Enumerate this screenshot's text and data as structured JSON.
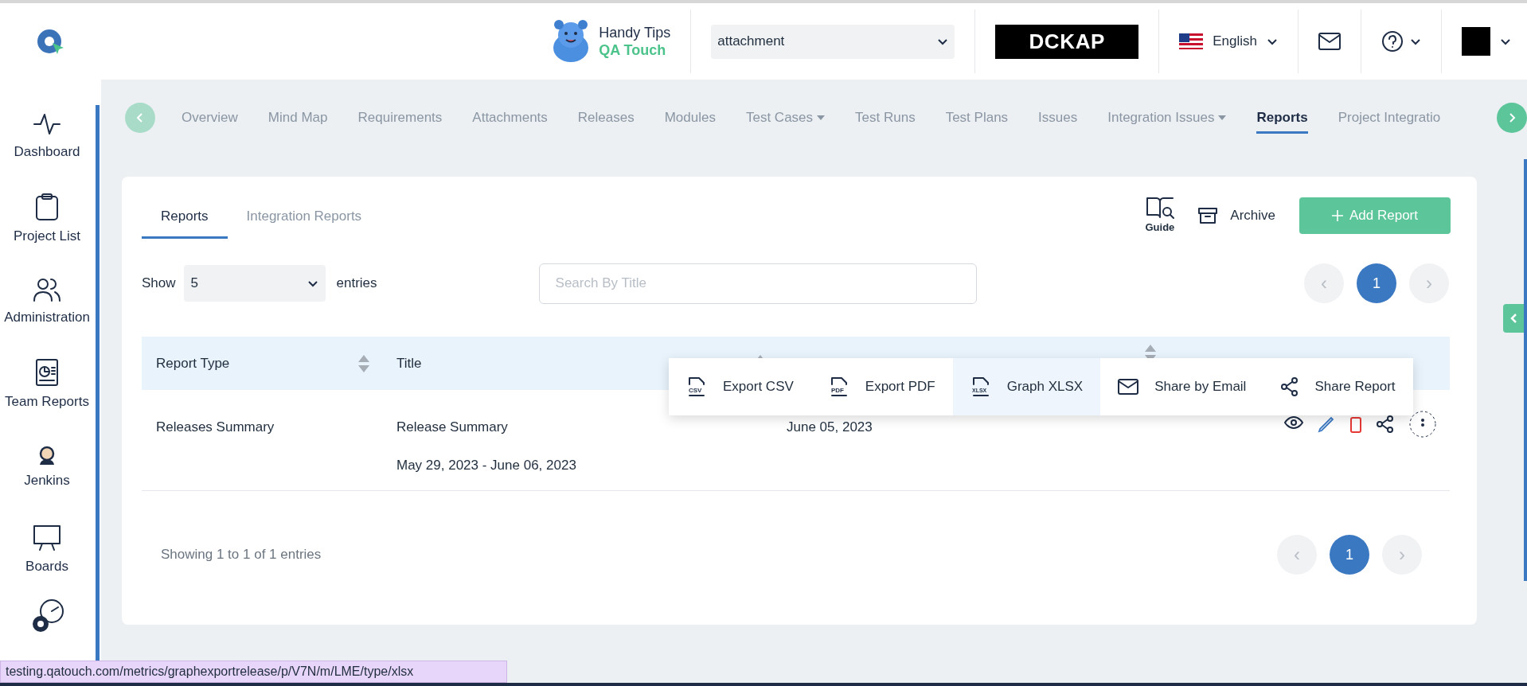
{
  "header": {
    "brand": {
      "line_1": "Handy Tips",
      "line_2": "QA Touch"
    },
    "project_select": {
      "value": "attachment"
    },
    "company_logo": "DCKAP",
    "language": {
      "label": "English"
    }
  },
  "sidebar": {
    "items": [
      {
        "label": "Dashboard"
      },
      {
        "label": "Project List"
      },
      {
        "label": "Administration"
      },
      {
        "label": "Team Reports"
      },
      {
        "label": "Jenkins"
      },
      {
        "label": "Boards"
      }
    ]
  },
  "nav_tabs": [
    {
      "label": "Overview",
      "selected": false,
      "dropdown": false
    },
    {
      "label": "Mind Map",
      "selected": false,
      "dropdown": false
    },
    {
      "label": "Requirements",
      "selected": false,
      "dropdown": false
    },
    {
      "label": "Attachments",
      "selected": false,
      "dropdown": false
    },
    {
      "label": "Releases",
      "selected": false,
      "dropdown": false
    },
    {
      "label": "Modules",
      "selected": false,
      "dropdown": false
    },
    {
      "label": "Test Cases",
      "selected": false,
      "dropdown": true
    },
    {
      "label": "Test Runs",
      "selected": false,
      "dropdown": false
    },
    {
      "label": "Test Plans",
      "selected": false,
      "dropdown": false
    },
    {
      "label": "Issues",
      "selected": false,
      "dropdown": false
    },
    {
      "label": "Integration Issues",
      "selected": false,
      "dropdown": true
    },
    {
      "label": "Reports",
      "selected": true,
      "dropdown": false
    },
    {
      "label": "Project Integratio",
      "selected": false,
      "dropdown": false
    }
  ],
  "card": {
    "tabs": [
      {
        "label": "Reports",
        "selected": true
      },
      {
        "label": "Integration Reports",
        "selected": false
      }
    ],
    "guide": "Guide",
    "archive": "Archive",
    "add_button": "Add Report",
    "show_label": "Show",
    "entries_value": "5",
    "entries_label": "entries",
    "search": {
      "placeholder": "Search By Title"
    },
    "pagination_top": {
      "prev": "‹",
      "next": "›",
      "pages": [
        {
          "label": "1",
          "selected": true
        }
      ]
    },
    "table": {
      "columns": [
        {
          "label": "Report Type"
        },
        {
          "label": "Title"
        }
      ],
      "rows": [
        {
          "report_type": "Releases Summary",
          "title": "Release Summary",
          "date_range": "May 29, 2023 - June 06, 2023",
          "created_date": "June 05, 2023"
        }
      ]
    },
    "context_menu": {
      "items": [
        {
          "label": "Export CSV",
          "icon_label": "CSV",
          "hovered": false
        },
        {
          "label": "Export PDF",
          "icon_label": "PDF",
          "hovered": false
        },
        {
          "label": "Graph XLSX",
          "icon_label": "XLSX",
          "hovered": true
        },
        {
          "label": "Share by Email",
          "hovered": false
        },
        {
          "label": "Share Report",
          "hovered": false
        }
      ]
    },
    "footer": {
      "summary": "Showing 1 to 1 of 1 entries",
      "prev": "‹",
      "next": "›",
      "pages": [
        {
          "label": "1",
          "selected": true
        }
      ]
    }
  },
  "status_bar": {
    "url": "testing.qatouch.com/metrics/graphexportrelease/p/V7N/m/LME/type/xlsx"
  }
}
